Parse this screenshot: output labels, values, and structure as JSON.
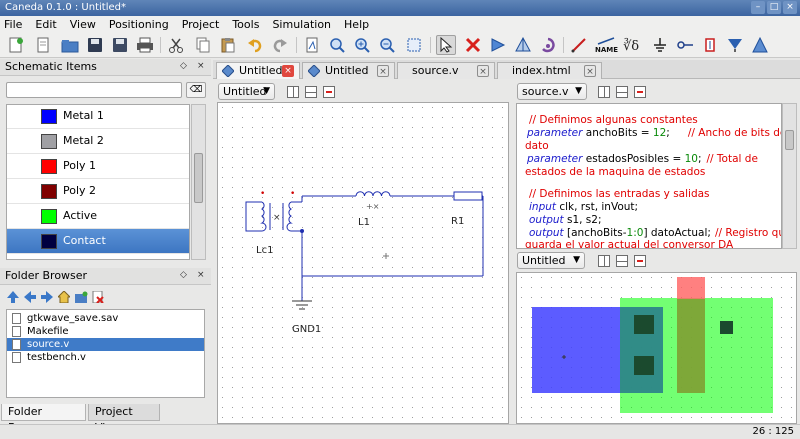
{
  "window": {
    "title": "Caneda 0.1.0 : Untitled*"
  },
  "menu": [
    "File",
    "Edit",
    "View",
    "Positioning",
    "Project",
    "Tools",
    "Simulation",
    "Help"
  ],
  "toolbar": {
    "icons": [
      "new-file-icon",
      "new-text-icon",
      "open-icon",
      "save-icon",
      "save-all-icon",
      "print-icon",
      "cut-icon",
      "copy-icon",
      "paste-icon",
      "undo-icon",
      "redo-icon",
      "document-icon",
      "zoom-fit-icon",
      "zoom-in-icon",
      "zoom-out-icon",
      "zoom-area-icon",
      "select-icon",
      "delete-icon",
      "mirror-x-icon",
      "mirror-y-icon",
      "rotate-icon",
      "wire-icon",
      "label-name-icon",
      "equation-icon",
      "ground-icon",
      "port-icon",
      "component-icon",
      "probe-icon",
      "simulate-icon"
    ],
    "name_label": "NAME"
  },
  "schematic_items": {
    "title": "Schematic Items",
    "search_placeholder": "",
    "items": [
      {
        "label": "Metal 1",
        "color": "#0000ff"
      },
      {
        "label": "Metal 2",
        "color": "#a0a0a4"
      },
      {
        "label": "Poly 1",
        "color": "#ff0000"
      },
      {
        "label": "Poly 2",
        "color": "#800000"
      },
      {
        "label": "Active",
        "color": "#00ff00"
      },
      {
        "label": "Contact",
        "color": "#000040",
        "selected": true
      }
    ]
  },
  "folder_browser": {
    "title": "Folder Browser",
    "files": [
      "gtkwave_save.sav",
      "Makefile",
      "source.v",
      "testbench.v"
    ],
    "selected": "source.v"
  },
  "bottom_tabs": [
    "Folder Browser",
    "Project View"
  ],
  "tabs": [
    "Untitled",
    "Untitled",
    "source.v",
    "index.html"
  ],
  "views": {
    "schematic": "Untitled",
    "code": "source.v",
    "layout": "Untitled"
  },
  "schematic": {
    "labels": {
      "lc1": "Lc1",
      "l1": "L1",
      "r1": "R1",
      "gnd": "GND1",
      "polarity": "+×"
    }
  },
  "code": {
    "c1": "// Definimos algunas constantes",
    "p1_kw": "parameter",
    "p1_name": "anchoBits",
    "p1_eq": " = ",
    "p1_val": "12",
    "p1_semi": ";",
    "p1_comment_a": "// Ancho de bits del",
    "p1_comment_b": "dato",
    "p2_kw": "parameter",
    "p2_name": "estadosPosibles",
    "p2_eq": " = ",
    "p2_val": "10",
    "p2_semi": ";",
    "p2_comment_a": "// Total de",
    "p2_comment_b": "estados de la maquina de estados",
    "c2": "// Definimos las entradas y salidas",
    "in_kw": "input",
    "in_rest": "clk, rst, inVout;",
    "out_kw": "output",
    "out_rest": "s1, s2;",
    "out2_kw": "output",
    "out2_a": "[anchoBits-",
    "out2_num": "1:0",
    "out2_b": "] datoActual;",
    "out2_comment_a": "// Registro que",
    "out2_comment_b": "guarda el valor actual del conversor DA"
  },
  "status": {
    "coords": "26 : 125"
  }
}
